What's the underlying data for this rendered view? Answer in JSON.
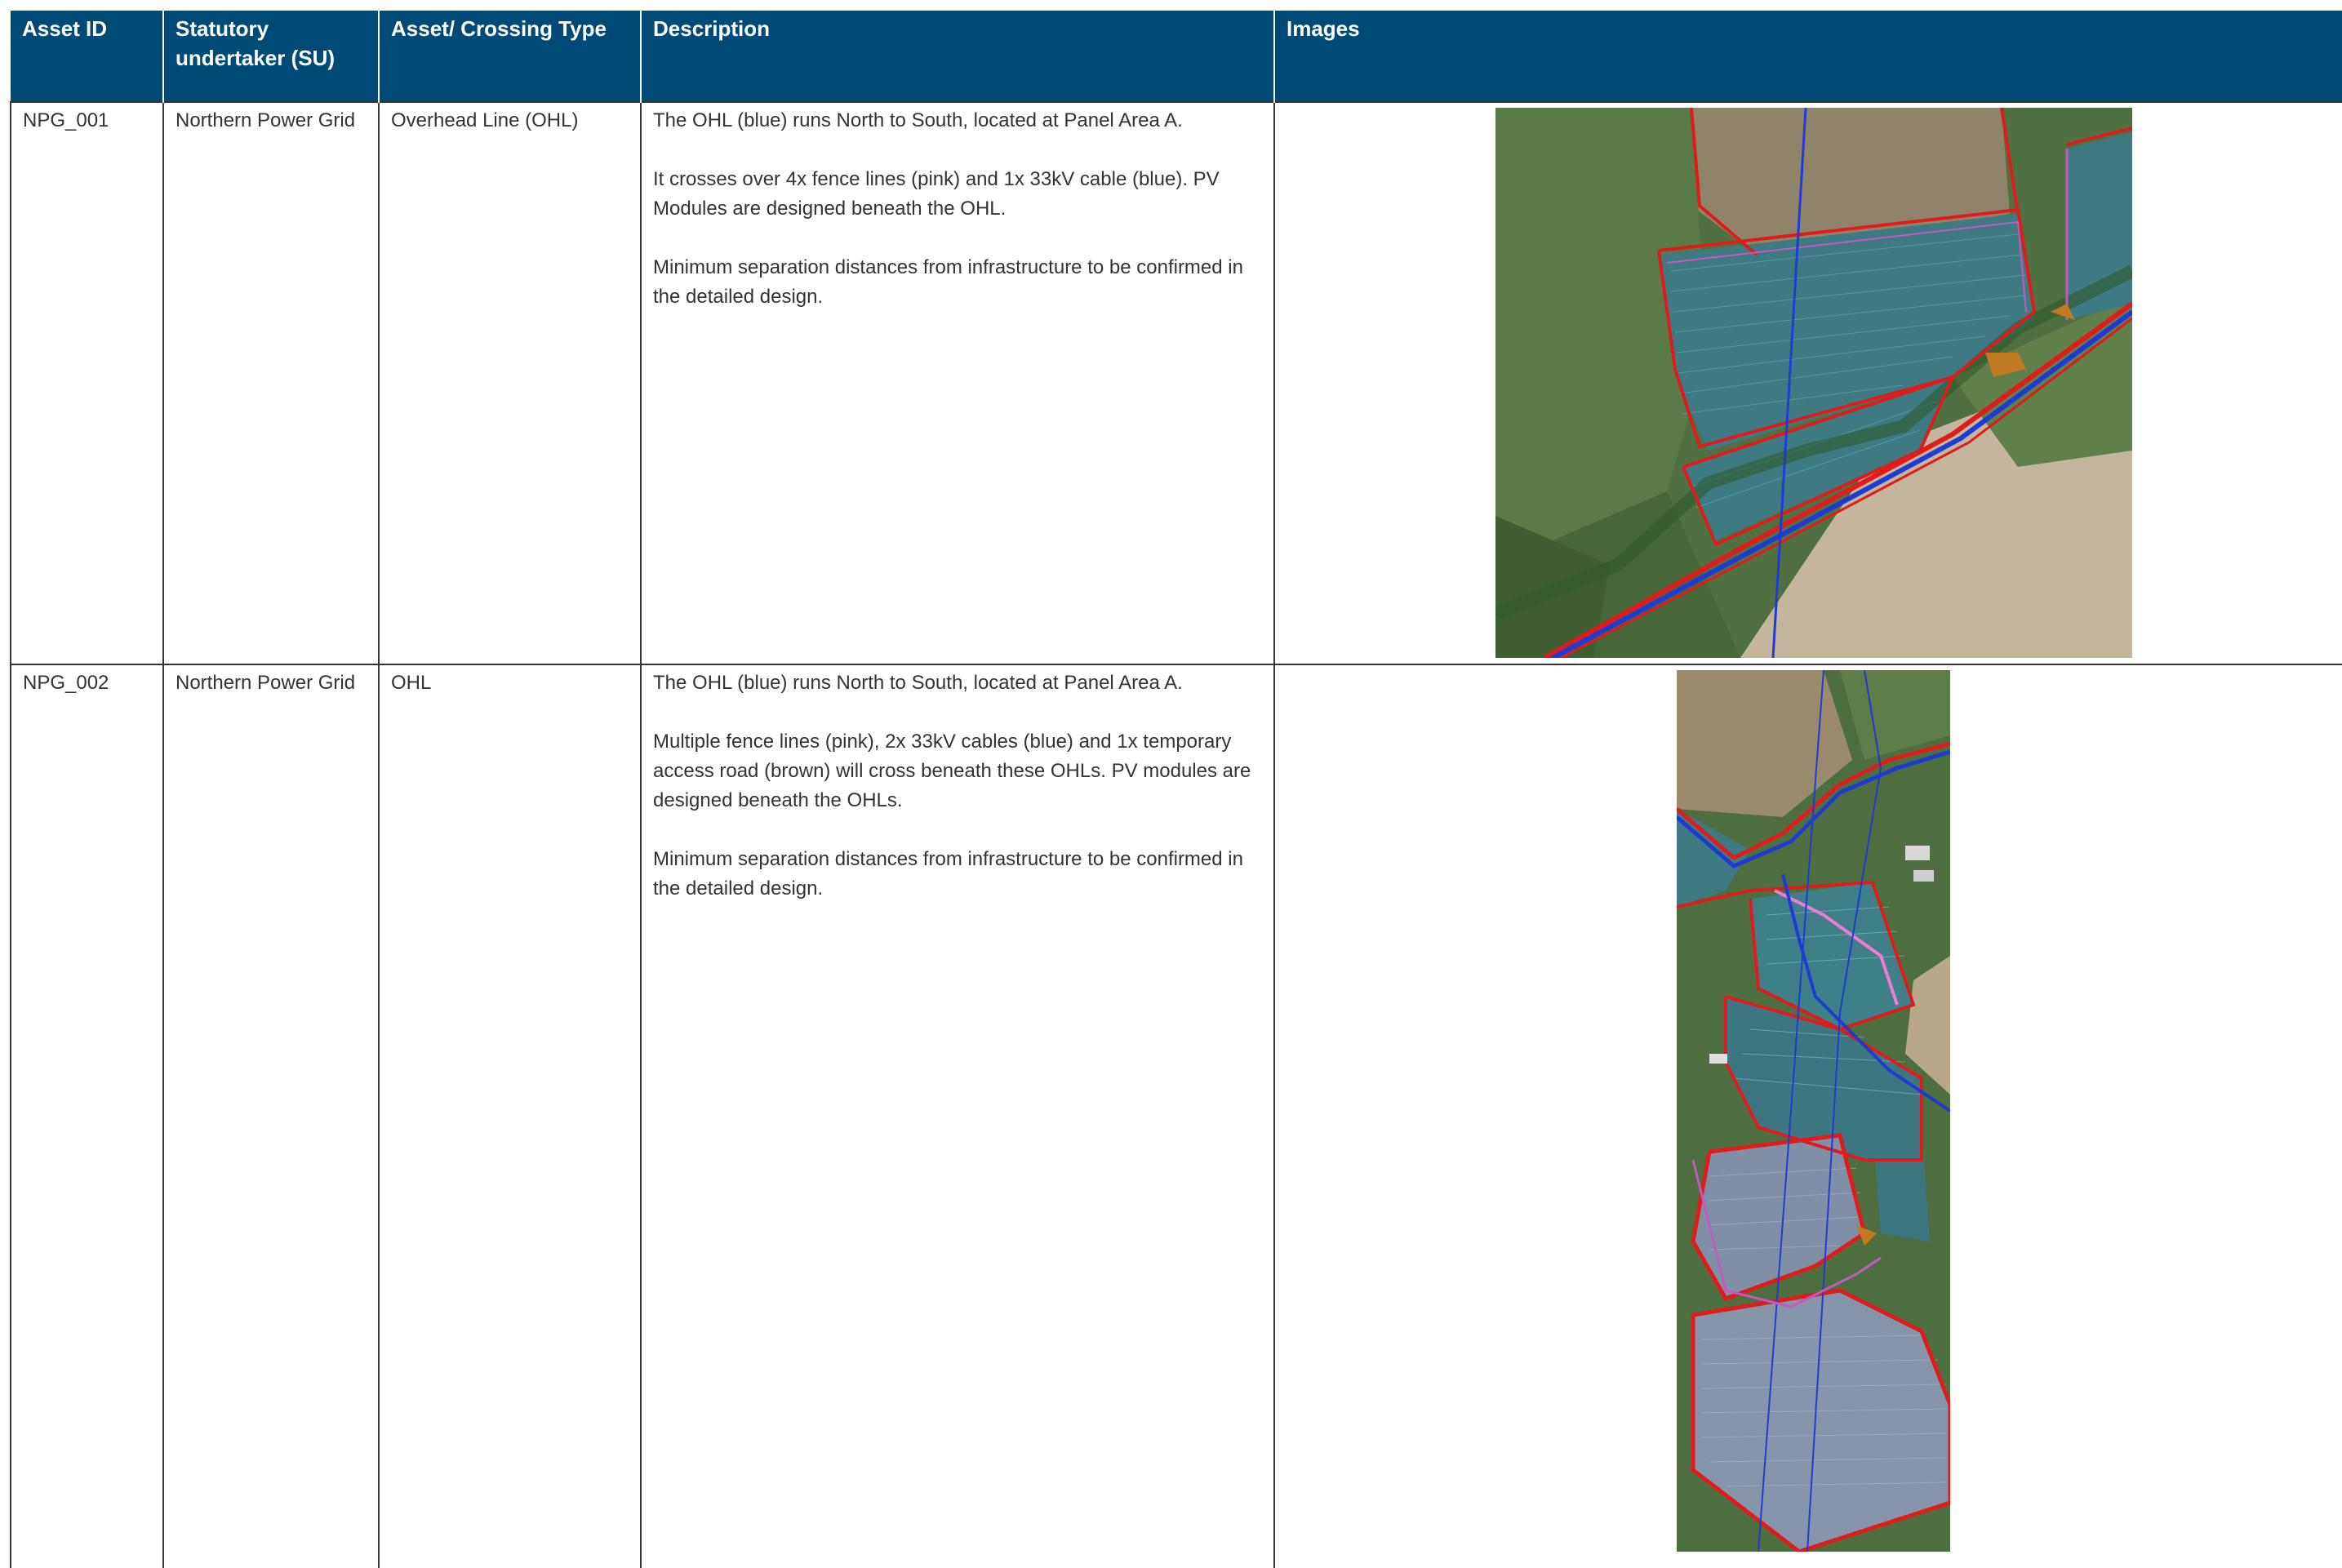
{
  "table": {
    "headers": [
      "Asset ID",
      "Statutory undertaker (SU)",
      "Asset/ Crossing Type",
      "Description",
      "Images"
    ],
    "rows": [
      {
        "asset_id": "NPG_001",
        "undertaker": "Northern Power Grid",
        "crossing_type": "Overhead Line (OHL)",
        "description": [
          "The OHL (blue) runs North to South, located at Panel Area A.",
          "It crosses over 4x fence lines (pink) and 1x 33kV cable (blue). PV Modules are designed beneath the OHL.",
          "Minimum separation distances from infrastructure to be confirmed in the detailed design."
        ],
        "image_name": "aerial-map-npg-001"
      },
      {
        "asset_id": "NPG_002",
        "undertaker": "Northern Power Grid",
        "crossing_type": "OHL",
        "description": [
          "The OHL (blue) runs North to South, located at Panel Area A.",
          "Multiple fence lines (pink), 2x 33kV cables (blue) and 1x temporary access road (brown) will cross beneath these OHLs. PV modules are designed beneath the OHLs.",
          "Minimum separation distances from infrastructure to be confirmed in the detailed design."
        ],
        "image_name": "aerial-map-npg-002"
      }
    ]
  },
  "colors": {
    "header_bg": "#004a77",
    "header_text": "#ffffff",
    "ohl_line": "#1f3bd6",
    "site_boundary": "#e01b1b",
    "fence_line": "#e36fd0",
    "access_road": "#b7791f",
    "pv_modules": "#3f8fa0"
  }
}
